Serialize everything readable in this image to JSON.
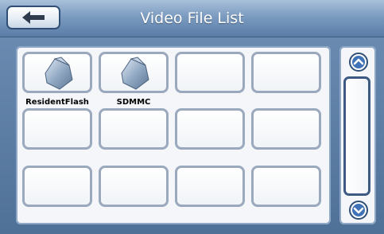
{
  "header": {
    "title": "Video File List",
    "back_icon": "arrow-left-icon"
  },
  "grid": {
    "tiles": [
      {
        "label": "ResidentFlash",
        "icon": "storage-folder-icon"
      },
      {
        "label": "SDMMC",
        "icon": "storage-folder-icon"
      },
      {
        "label": "",
        "icon": ""
      },
      {
        "label": "",
        "icon": ""
      },
      {
        "label": "",
        "icon": ""
      },
      {
        "label": "",
        "icon": ""
      },
      {
        "label": "",
        "icon": ""
      },
      {
        "label": "",
        "icon": ""
      },
      {
        "label": "",
        "icon": ""
      },
      {
        "label": "",
        "icon": ""
      },
      {
        "label": "",
        "icon": ""
      },
      {
        "label": "",
        "icon": ""
      }
    ]
  },
  "scrollbar": {
    "up_icon": "chevron-up-icon",
    "down_icon": "chevron-down-icon"
  },
  "colors": {
    "header_text": "#ffffff",
    "accent": "#2f4f77",
    "tile_border": "#9aa9bd"
  }
}
